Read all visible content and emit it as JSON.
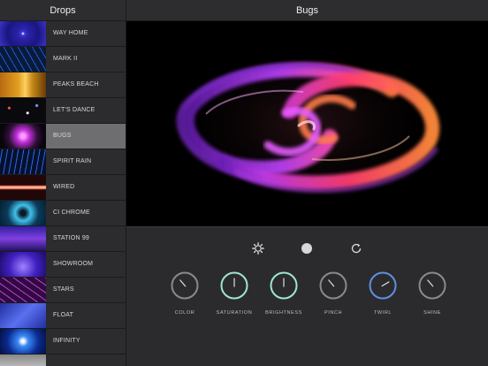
{
  "sidebar": {
    "title": "Drops",
    "items": [
      {
        "label": "WAY HOME",
        "thumb": "wayhome"
      },
      {
        "label": "MARK II",
        "thumb": "mark"
      },
      {
        "label": "PEAKS BEACH",
        "thumb": "peaks"
      },
      {
        "label": "LET'S DANCE",
        "thumb": "dance"
      },
      {
        "label": "BUGS",
        "thumb": "bugs",
        "selected": true
      },
      {
        "label": "SPIRIT RAIN",
        "thumb": "spirit"
      },
      {
        "label": "WIRED",
        "thumb": "wired"
      },
      {
        "label": "CI CHROME",
        "thumb": "chrome"
      },
      {
        "label": "STATION 99",
        "thumb": "station"
      },
      {
        "label": "SHOWROOM",
        "thumb": "showroom"
      },
      {
        "label": "STARS",
        "thumb": "stars"
      },
      {
        "label": "FLOAT",
        "thumb": "float"
      },
      {
        "label": "INFINITY",
        "thumb": "infinity"
      },
      {
        "label": "",
        "thumb": "extra"
      }
    ]
  },
  "main": {
    "title": "Bugs"
  },
  "toolbar": {
    "left_icon": "gear-icon",
    "center_icon": "record-dot-icon",
    "right_icon": "reset-icon"
  },
  "knobs": [
    {
      "label": "COLOR",
      "level": 0.35,
      "ring": "gray"
    },
    {
      "label": "SATURATION",
      "level": 0.5,
      "ring": "teal"
    },
    {
      "label": "BRIGHTNESS",
      "level": 0.5,
      "ring": "teal"
    },
    {
      "label": "PINCH",
      "level": 0.35,
      "ring": "gray"
    },
    {
      "label": "TWIRL",
      "level": 0.72,
      "ring": "blue"
    },
    {
      "label": "SHINE",
      "level": 0.35,
      "ring": "gray"
    }
  ],
  "colors": {
    "gray": "#8a8a8e",
    "teal": "#9fe6cf",
    "blue": "#5f8fe3"
  }
}
